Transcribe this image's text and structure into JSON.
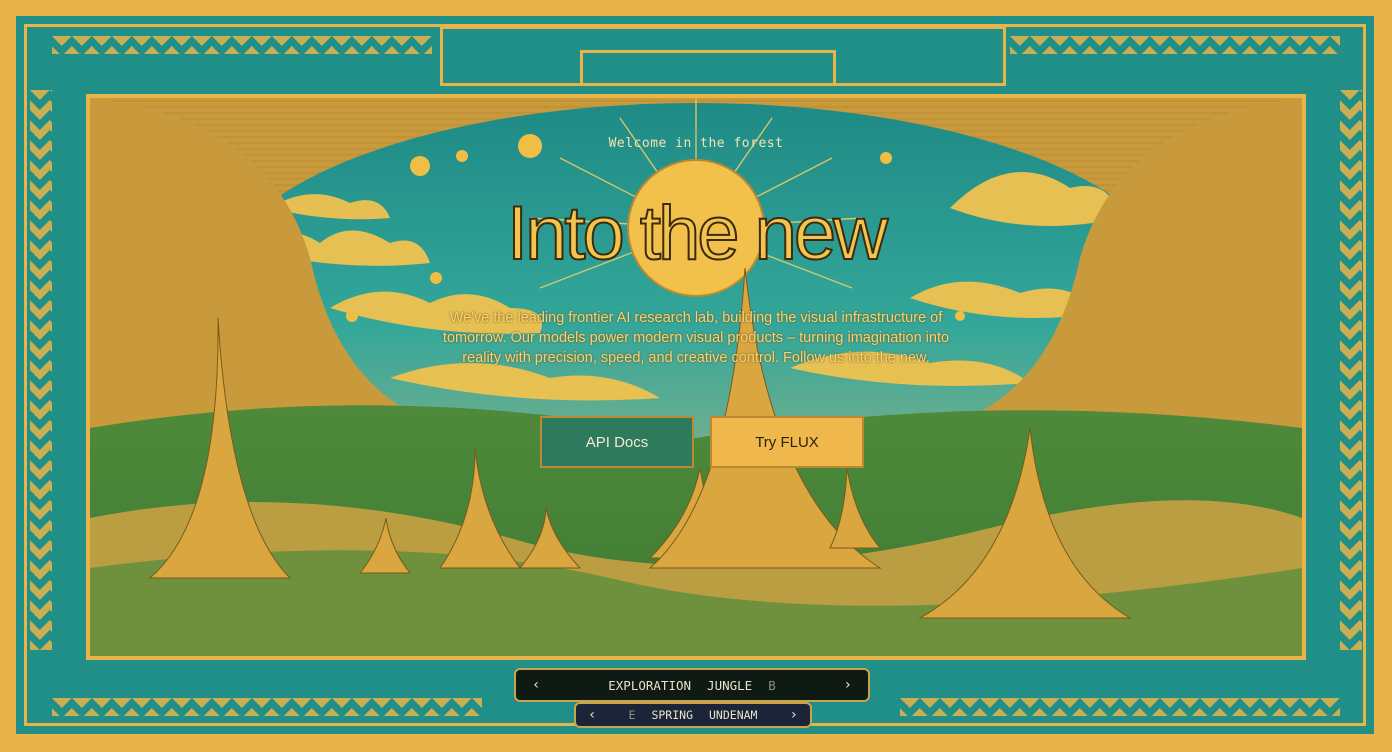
{
  "hero": {
    "welcome": "Welcome in the forest",
    "headline": "Into the new",
    "description": "We've the leading frontier AI research lab, building the visual infrastructure of tomorrow. Our models power modern visual products – turning imagination into reality with precision, speed, and creative control. Follow us into the new.",
    "primary_button": "API Docs",
    "secondary_button": "Try FLUX"
  },
  "carousel": {
    "row1": {
      "prev_icon": "chevron-left-icon",
      "next_icon": "chevron-right-icon",
      "labels": [
        "EXPLORATION",
        "JUNGLE",
        "B"
      ]
    },
    "row2": {
      "prev_icon": "chevron-left-icon",
      "next_icon": "chevron-right-icon",
      "labels": [
        "E",
        "SPRING",
        "UNDENAM"
      ]
    }
  },
  "colors": {
    "teal": "#1f8f88",
    "gold": "#e8b44a",
    "green_button": "#2e7a5c",
    "sky": "#2aa39a"
  }
}
